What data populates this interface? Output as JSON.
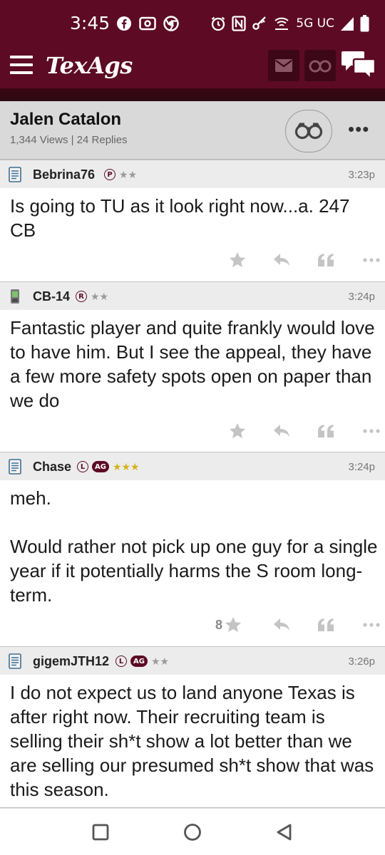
{
  "status_bar": {
    "time": "3:45",
    "network": "5G UC",
    "icons": [
      "facebook-icon",
      "camera-icon",
      "chrome-icon",
      "alarm-icon",
      "nfc-icon",
      "key-icon",
      "wifi-calling-icon",
      "signal-icon",
      "battery-icon"
    ]
  },
  "app_bar": {
    "logo": "TexAgs",
    "icons": [
      "menu-icon",
      "mail-icon",
      "binoculars-icon",
      "chat-icon"
    ]
  },
  "thread": {
    "title": "Jalen Catalon",
    "meta": "1,344 Views | 24 Replies"
  },
  "posts": [
    {
      "username": "Bebrina76",
      "badges": [
        "P"
      ],
      "ag": false,
      "stars": "★★",
      "stars_color": "gray",
      "time": "3:23p",
      "device": "desktop",
      "body": "Is going to TU as it look right now...a. 247 CB",
      "like_count": ""
    },
    {
      "username": "CB-14",
      "badges": [
        "R"
      ],
      "ag": false,
      "stars": "★★",
      "stars_color": "gray",
      "time": "3:24p",
      "device": "mobile",
      "body": "Fantastic player and quite frankly would love to have him. But I see the appeal, they have a few more safety spots open on paper than we do",
      "like_count": ""
    },
    {
      "username": "Chase",
      "badges": [
        "L"
      ],
      "ag": true,
      "ag_label": "AG",
      "stars": "★★★",
      "stars_color": "gold",
      "time": "3:24p",
      "device": "desktop",
      "body": "meh.\n\nWould rather not pick up one guy for a single year if it potentially harms the S room long-term.",
      "like_count": "8"
    },
    {
      "username": "gigemJTH12",
      "badges": [
        "L"
      ],
      "ag": true,
      "ag_label": "AG",
      "stars": "★★",
      "stars_color": "gray",
      "time": "3:26p",
      "device": "desktop",
      "body": "I do not expect us to land anyone Texas is after right now. Their recruiting team is selling their sh*t show a lot better than we are selling our presumed sh*t show that was this season.",
      "like_count": ""
    }
  ],
  "colors": {
    "brand": "#5d0b25",
    "header_gray": "#d9d9d9",
    "post_header": "#ececec",
    "gold_star": "#d4b21c"
  },
  "nav_bar": {
    "icons": [
      "recent-apps-icon",
      "home-icon",
      "back-icon"
    ]
  }
}
